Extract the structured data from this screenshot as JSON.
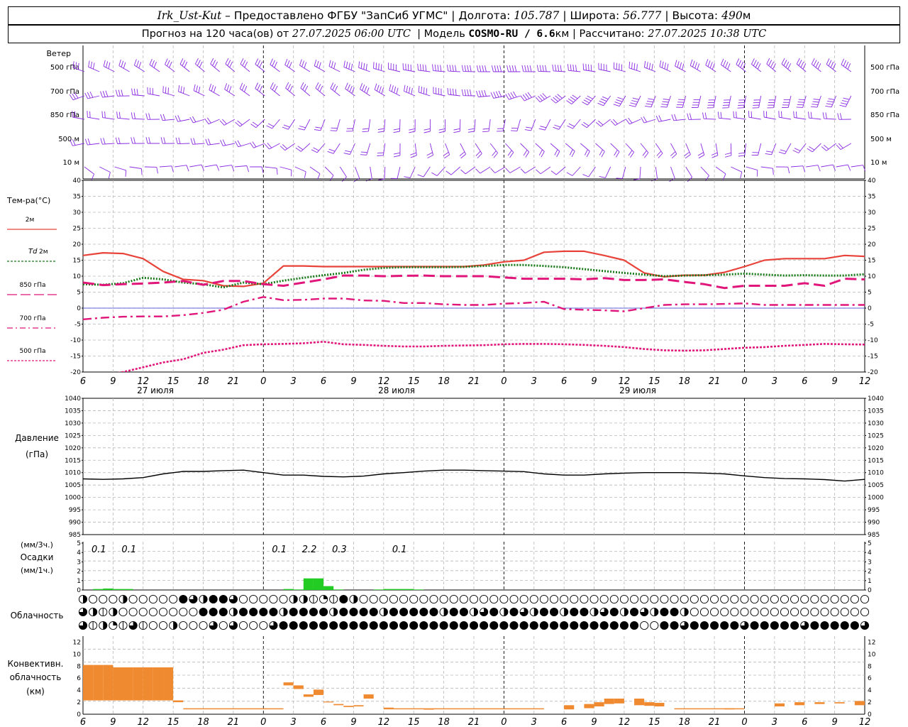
{
  "header": {
    "station": "Irk_Ust-Kut",
    "dash": "–",
    "provider": "Предоставлено ФГБУ \"ЗапСиб УГМС\"",
    "sep": "|",
    "lon_label": "Долгота:",
    "lon": "105.787",
    "lat_label": "Широта:",
    "lat": "56.777",
    "alt_label": "Высота:",
    "alt": "490",
    "alt_unit": "м",
    "forecast_prefix": "Прогноз на 120 часа(ов) от",
    "forecast_time": "27.07.2025 06:00 UTC",
    "model_label": "Модель",
    "model": "COSMO-RU / 6.6",
    "model_unit": "км",
    "computed_label": "Рассчитано:",
    "computed_time": "27.07.2025 10:38 UTC"
  },
  "x_ticks": [
    "6",
    "9",
    "12",
    "15",
    "18",
    "21",
    "0",
    "3",
    "6",
    "9",
    "12",
    "15",
    "18",
    "21",
    "0",
    "3",
    "6",
    "9",
    "12",
    "15",
    "18",
    "21",
    "0",
    "3",
    "6",
    "9",
    "12"
  ],
  "dates": [
    "27 июля",
    "28 июля",
    "29 июля"
  ],
  "colors": {
    "wind": "#8a2be2",
    "t2m": "#e8433a",
    "td2m": "#1a7a1a",
    "t850": "#e0167a",
    "t700": "#e0167a",
    "t500": "#e0167a",
    "pressure": "#000000",
    "precip": "#22cc22",
    "convective": "#f08a30",
    "grid": "#b8b8b8"
  },
  "wind_panel": {
    "title": "Ветер",
    "levels": [
      "500 гПа",
      "700 гПа",
      "850 гПа",
      "500 м",
      "10 м"
    ]
  },
  "temp_panel": {
    "title": "Тем-ра(°C)",
    "legend": [
      {
        "label": "2м",
        "style": "solid",
        "color": "#e8433a"
      },
      {
        "label_it": "Td",
        "label": "2м",
        "style": "dotted",
        "color": "#1a7a1a"
      },
      {
        "label": "850 гПа",
        "style": "dashed",
        "color": "#e0167a"
      },
      {
        "label": "700 гПа",
        "style": "dashdot",
        "color": "#e0167a"
      },
      {
        "label": "500 гПа",
        "style": "dotted",
        "color": "#e0167a"
      }
    ],
    "y_ticks": [
      "40",
      "35",
      "30",
      "25",
      "20",
      "15",
      "10",
      "5",
      "0",
      "-5",
      "-10",
      "-15",
      "-20"
    ]
  },
  "pressure_panel": {
    "title": "Давление",
    "unit": "(гПа)",
    "y_ticks": [
      "1040",
      "1035",
      "1030",
      "1025",
      "1020",
      "1015",
      "1010",
      "1005",
      "1000",
      "995",
      "990",
      "985"
    ]
  },
  "precip_panel": {
    "unit3": "(мм/3ч.)",
    "title": "Осадки",
    "unit1": "(мм/1ч.)",
    "y_ticks": [
      "5",
      "4",
      "3",
      "2",
      "1",
      "0"
    ],
    "amounts3h": [
      {
        "h": 3,
        "label": "0.1"
      },
      {
        "h": 6,
        "label": "0.1"
      },
      {
        "h": 21,
        "label": "0.1"
      },
      {
        "h": 24,
        "label": "2.2"
      },
      {
        "h": 27,
        "label": "0.3"
      },
      {
        "h": 33,
        "label": "0.1"
      }
    ]
  },
  "cloud_panel": {
    "title": "Облачность"
  },
  "convective_panel": {
    "title1": "Конвективн.",
    "title2": "облачность",
    "unit": "(км)",
    "y_ticks": [
      "12",
      "10",
      "8",
      "6",
      "4",
      "2",
      "0"
    ]
  },
  "chart_data": [
    {
      "type": "line",
      "title": "Тем-ра(°C)",
      "x_hours_from_start": [
        0,
        2,
        4,
        6,
        8,
        10,
        12,
        14,
        16,
        18,
        20,
        22,
        24,
        26,
        28,
        30,
        32,
        34,
        36,
        38,
        40,
        42,
        44,
        46,
        48,
        50,
        52,
        54,
        56,
        58,
        60,
        62,
        64,
        66,
        68,
        70,
        72,
        74,
        76,
        78
      ],
      "ylim": [
        -20,
        40
      ],
      "series": [
        {
          "name": "2м",
          "values": [
            16.5,
            17.3,
            17.1,
            15.5,
            11.5,
            9,
            8.6,
            7,
            6.8,
            7.8,
            13.2,
            13.2,
            13,
            13,
            13,
            13,
            13,
            13,
            13,
            13,
            13.5,
            14.5,
            15,
            17.5,
            17.8,
            17.8,
            16.5,
            15,
            11,
            9.8,
            10.3,
            10.3,
            11.2,
            13,
            15,
            15.5,
            15.5,
            15.5,
            16.5,
            16.2
          ]
        },
        {
          "name": "Td 2м",
          "values": [
            7.5,
            7.3,
            7.8,
            9.5,
            9,
            8,
            7.5,
            6.5,
            8,
            7.5,
            8.6,
            9.5,
            10.3,
            11,
            12,
            12.6,
            12.8,
            12.8,
            12.8,
            12.9,
            13.2,
            13.5,
            13.5,
            13.2,
            12.8,
            12.2,
            11.6,
            11,
            10.5,
            10,
            10.2,
            10.3,
            10.5,
            10.8,
            10.5,
            10.2,
            10.3,
            10.2,
            10.2,
            10.6
          ]
        },
        {
          "name": "850 гПа",
          "values": [
            8,
            7.2,
            7.5,
            7.7,
            8,
            8.5,
            7.3,
            8.5,
            8.5,
            7.5,
            7,
            8,
            9,
            10.2,
            10.2,
            10,
            10.1,
            10.2,
            10,
            10,
            10,
            9.6,
            9.2,
            9.2,
            9.2,
            9,
            9.4,
            8.8,
            8.8,
            9,
            8.2,
            7.5,
            6.3,
            7,
            7,
            7,
            7.8,
            7,
            9.2,
            9
          ]
        },
        {
          "name": "700 гПа",
          "values": [
            -3.5,
            -3,
            -2.7,
            -2.6,
            -2.6,
            -2.2,
            -1.5,
            -0.5,
            2,
            3.5,
            2.5,
            2.6,
            3,
            3,
            2.4,
            2.3,
            1.6,
            1.6,
            1.2,
            1,
            1,
            1.4,
            1.6,
            2,
            -0.3,
            -0.5,
            -0.7,
            -1,
            0,
            1,
            1.2,
            1.2,
            1.3,
            1.5,
            1,
            1,
            1,
            1,
            1,
            1
          ]
        },
        {
          "name": "500 гПа",
          "values": [
            -22,
            -21,
            -20,
            -18.5,
            -17,
            -16,
            -14,
            -13,
            -11.6,
            -11.3,
            -11.2,
            -11,
            -10.5,
            -11.3,
            -11.5,
            -11.8,
            -12,
            -12,
            -11.8,
            -11.7,
            -11.6,
            -11.3,
            -11.2,
            -11.2,
            -11.3,
            -11.5,
            -11.8,
            -12.2,
            -12.8,
            -13.2,
            -13.3,
            -13.2,
            -12.8,
            -12.4,
            -12.2,
            -11.8,
            -11.5,
            -11.2,
            -11.3,
            -11.4
          ]
        }
      ]
    },
    {
      "type": "line",
      "title": "Давление",
      "x_hours_from_start": [
        0,
        2,
        4,
        6,
        8,
        10,
        12,
        14,
        16,
        18,
        20,
        22,
        24,
        26,
        28,
        30,
        32,
        34,
        36,
        38,
        40,
        42,
        44,
        46,
        48,
        50,
        52,
        54,
        56,
        58,
        60,
        62,
        64,
        66,
        68,
        70,
        72,
        74,
        76,
        78
      ],
      "ylim": [
        985,
        1040
      ],
      "series": [
        {
          "name": "Давление",
          "values": [
            1007.5,
            1007.3,
            1007.5,
            1008,
            1009.5,
            1010.5,
            1010.5,
            1010.8,
            1011,
            1010,
            1009,
            1009,
            1008.5,
            1008.3,
            1008.6,
            1009.5,
            1010,
            1010.6,
            1011,
            1011,
            1010.8,
            1010.6,
            1010.4,
            1009.5,
            1009,
            1009,
            1009.5,
            1009.8,
            1010,
            1010,
            1010,
            1009.8,
            1009.5,
            1008.7,
            1008,
            1007.6,
            1007.5,
            1007.2,
            1006.6,
            1007.3
          ]
        }
      ]
    },
    {
      "type": "bar",
      "title": "Осадки",
      "unit": "мм/1ч.",
      "ylim": [
        0,
        5
      ],
      "x_hours_from_start": [
        2,
        3,
        4,
        5,
        21,
        22,
        23,
        24,
        25,
        26,
        30,
        31,
        32,
        33,
        34
      ],
      "values": [
        0.1,
        0.15,
        0.1,
        0.1,
        0.1,
        0.05,
        1.2,
        1.2,
        0.4,
        0.05,
        0.05,
        0.1,
        0.1,
        0.1,
        0.05
      ]
    },
    {
      "type": "bar",
      "title": "Конвективн. облачность",
      "unit": "км",
      "ylim": [
        0,
        12
      ],
      "x_hours_from_start": [
        0.5,
        1.5,
        2.5,
        3.5,
        4.5,
        5.5,
        6.5,
        7.5,
        8.5,
        9.5,
        20.5,
        21.5,
        22.5,
        23.5,
        24.5,
        25.5,
        26.5,
        27.5,
        28.5,
        30.5,
        34.5,
        48.5,
        50.5,
        51.5,
        52.5,
        53.5,
        55.5,
        56.5,
        57.5,
        64.5,
        69.5,
        71.5,
        73.5,
        75.5,
        77.5
      ],
      "bottom": [
        2.3,
        2.3,
        2.3,
        2.3,
        2.3,
        2.3,
        2.3,
        2.3,
        2.3,
        2,
        4.8,
        4.2,
        2.9,
        3.2,
        2,
        1.5,
        1.2,
        1.3,
        2.6,
        1,
        0.8,
        0.8,
        1,
        1.3,
        1.7,
        1.8,
        1.5,
        1.4,
        1.3,
        0.8,
        1.3,
        1.5,
        1.7,
        1.8,
        1.5
      ],
      "top": [
        8.2,
        8.2,
        8.2,
        7.8,
        7.8,
        7.8,
        7.8,
        7.8,
        7.8,
        2.3,
        5.3,
        4.8,
        3.3,
        4.1,
        2.1,
        1.7,
        1.4,
        1.5,
        3.3,
        1.1,
        0.9,
        1.5,
        1.7,
        2,
        2.6,
        2.6,
        2.6,
        2,
        1.9,
        1,
        1.8,
        2,
        2,
        2,
        2.2
      ]
    }
  ]
}
